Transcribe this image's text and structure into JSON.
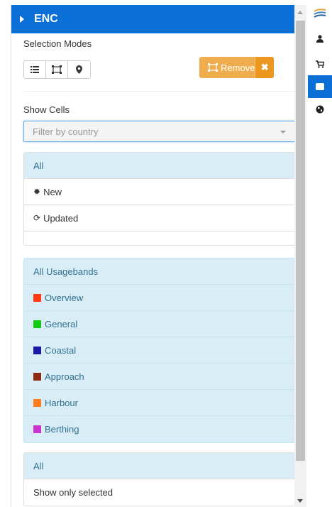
{
  "panel": {
    "title": "ENC",
    "selection_modes_label": "Selection Modes",
    "remove_label": "Remove",
    "remove_close": "✖",
    "show_cells_label": "Show Cells",
    "filter_placeholder": "Filter by country"
  },
  "status_list": {
    "items": [
      {
        "label": "All"
      },
      {
        "label": "New"
      },
      {
        "label": "Updated"
      }
    ]
  },
  "usagebands": {
    "header": "All Usagebands",
    "items": [
      {
        "label": "Overview",
        "color": "#ff3a10"
      },
      {
        "label": "General",
        "color": "#11cc11"
      },
      {
        "label": "Coastal",
        "color": "#1a1aa8"
      },
      {
        "label": "Approach",
        "color": "#8b2a0f"
      },
      {
        "label": "Harbour",
        "color": "#ff7a1a"
      },
      {
        "label": "Berthing",
        "color": "#cc33cc"
      }
    ]
  },
  "bottom_list": {
    "items": [
      {
        "label": "All"
      },
      {
        "label": "Show only selected"
      }
    ]
  },
  "colors": {
    "accent": "#0a6fd6",
    "warning": "#f0ad4e",
    "info_bg": "#d9edf7"
  },
  "rail_icons": [
    "waves-logo-icon",
    "user-icon",
    "cart-icon",
    "square-icon",
    "globe-icon"
  ]
}
